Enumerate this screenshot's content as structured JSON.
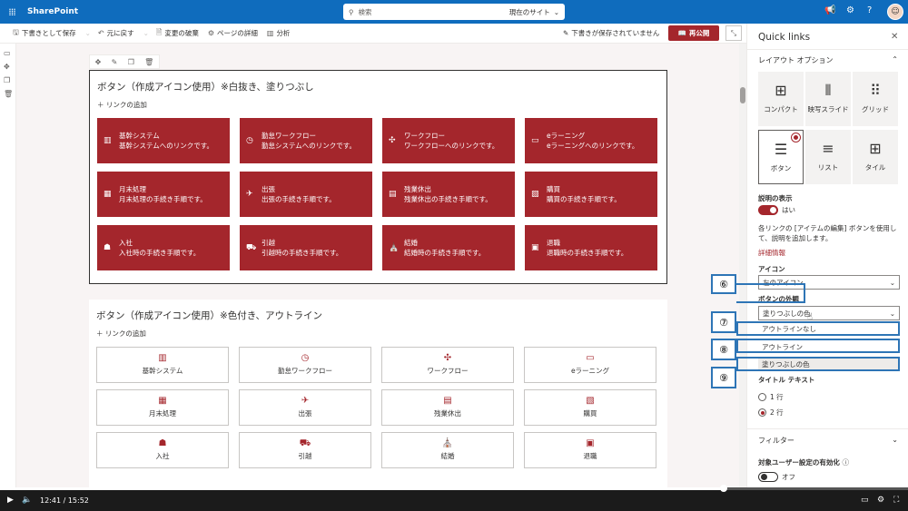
{
  "suite": {
    "app_name": "SharePoint",
    "search_placeholder": "検索",
    "search_scope": "現在のサイト"
  },
  "commands": {
    "save_draft": "下書きとして保存",
    "undo": "元に戻す",
    "discard": "変更の破棄",
    "page_details": "ページの詳細",
    "analytics": "分析",
    "saved_status": "下書きが保存されていません",
    "republish": "再公開"
  },
  "section1": {
    "title": "ボタン（作成アイコン使用）※白抜き、塗りつぶし",
    "add_link": "リンクの追加",
    "tiles": [
      {
        "title": "基幹システム",
        "desc": "基幹システムへのリンクです。",
        "icon": "building-icon",
        "glyph": "▥"
      },
      {
        "title": "勤怠ワークフロー",
        "desc": "勤怠システムへのリンクです。",
        "icon": "clock-icon",
        "glyph": "◷"
      },
      {
        "title": "ワークフロー",
        "desc": "ワークフローへのリンクです。",
        "icon": "workflow-icon",
        "glyph": "✣"
      },
      {
        "title": "eラーニング",
        "desc": "eラーニングへのリンクです。",
        "icon": "monitor-icon",
        "glyph": "▭"
      },
      {
        "title": "月末処理",
        "desc": "月末処理の手続き手順です。",
        "icon": "calendar-icon",
        "glyph": "▦"
      },
      {
        "title": "出張",
        "desc": "出張の手続き手順です。",
        "icon": "plane-icon",
        "glyph": "✈"
      },
      {
        "title": "残業休出",
        "desc": "残業休出の手続き手順です。",
        "icon": "window-icon",
        "glyph": "▤"
      },
      {
        "title": "購買",
        "desc": "購買の手続き手順です。",
        "icon": "shop-icon",
        "glyph": "▧"
      },
      {
        "title": "入社",
        "desc": "入社時の手続き手順です。",
        "icon": "person-icon",
        "glyph": "☗"
      },
      {
        "title": "引越",
        "desc": "引越時の手続き手順です。",
        "icon": "truck-icon",
        "glyph": "⛟"
      },
      {
        "title": "結婚",
        "desc": "結婚時の手続き手順です。",
        "icon": "church-icon",
        "glyph": "⛪"
      },
      {
        "title": "退職",
        "desc": "退職時の手続き手順です。",
        "icon": "bag-icon",
        "glyph": "▣"
      }
    ]
  },
  "section2": {
    "title": "ボタン（作成アイコン使用）※色付き、アウトライン",
    "add_link": "リンクの追加",
    "tiles": [
      {
        "title": "基幹システム",
        "icon": "building-icon",
        "glyph": "▥"
      },
      {
        "title": "勤怠ワークフロー",
        "icon": "clock-icon",
        "glyph": "◷"
      },
      {
        "title": "ワークフロー",
        "icon": "workflow-icon",
        "glyph": "✣"
      },
      {
        "title": "eラーニング",
        "icon": "monitor-icon",
        "glyph": "▭"
      },
      {
        "title": "月末処理",
        "icon": "calendar-icon",
        "glyph": "▦"
      },
      {
        "title": "出張",
        "icon": "plane-icon",
        "glyph": "✈"
      },
      {
        "title": "残業休出",
        "icon": "window-icon",
        "glyph": "▤"
      },
      {
        "title": "購買",
        "icon": "shop-icon",
        "glyph": "▧"
      },
      {
        "title": "入社",
        "icon": "person-icon",
        "glyph": "☗"
      },
      {
        "title": "引越",
        "icon": "truck-icon",
        "glyph": "⛟"
      },
      {
        "title": "結婚",
        "icon": "church-icon",
        "glyph": "⛪"
      },
      {
        "title": "退職",
        "icon": "bag-icon",
        "glyph": "▣"
      }
    ]
  },
  "pane": {
    "title": "Quick links",
    "layout_header": "レイアウト オプション",
    "layouts": [
      {
        "label": "コンパクト",
        "glyph": "⊞",
        "selected": false
      },
      {
        "label": "映写スライド",
        "glyph": "⫴",
        "selected": false
      },
      {
        "label": "グリッド",
        "glyph": "⠿",
        "selected": false
      },
      {
        "label": "ボタン",
        "glyph": "☰",
        "selected": true
      },
      {
        "label": "リスト",
        "glyph": "≡",
        "selected": false
      },
      {
        "label": "タイル",
        "glyph": "⊞",
        "selected": false
      }
    ],
    "show_desc_label": "説明の表示",
    "show_desc_state": "はい",
    "desc_hint": "各リンクの [アイテムの編集] ボタンを使用して、説明を追加します。",
    "more_info": "詳細情報",
    "icon_label": "アイコン",
    "icon_value": "左のアイコン",
    "appearance_label": "ボタンの外観",
    "appearance_value": "塗りつぶしの色",
    "options": [
      "アウトラインなし",
      "アウトライン",
      "塗りつぶしの色"
    ],
    "title_text_label": "タイトル テキスト",
    "title_options": [
      "1 行",
      "2 行"
    ],
    "filter_header": "フィルター",
    "audience_label": "対象ユーザー設定の有効化",
    "audience_state": "オフ"
  },
  "annotations": {
    "c6": "⑥",
    "c7": "⑦",
    "c8": "⑧",
    "c9": "⑨"
  },
  "video": {
    "current": "12:41",
    "total": "15:52",
    "progress": 0.797
  },
  "colors": {
    "accent": "#a4262c",
    "suite": "#0f6cbd",
    "annotation": "#2e75b6"
  }
}
